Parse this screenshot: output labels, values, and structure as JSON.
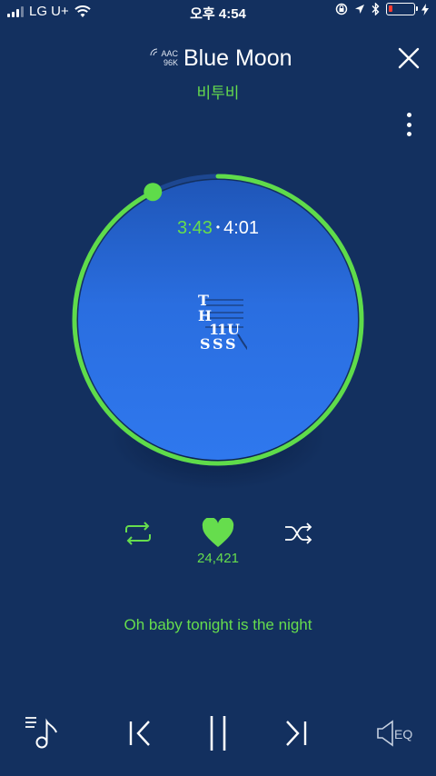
{
  "status_bar": {
    "carrier": "LG U+",
    "time": "오후 4:54",
    "battery_level": 0.1,
    "icons": [
      "signal-icon",
      "wifi-icon",
      "rotation-lock-icon",
      "location-icon",
      "bluetooth-icon",
      "battery-icon",
      "charging-icon"
    ]
  },
  "header": {
    "codec_line1": "AAC",
    "codec_line2": "96K",
    "title": "Blue Moon",
    "artist": "비투비",
    "close_icon": "close-icon",
    "more_icon": "more-vertical-icon"
  },
  "player": {
    "current_time": "3:43",
    "total_time": "4:01",
    "progress": 0.925,
    "album_art_letters": [
      "T",
      "H",
      "1",
      "1",
      "U",
      "S",
      "S",
      "S"
    ]
  },
  "actions": {
    "like_count": "24,421",
    "liked": true,
    "repeat_icon": "repeat-icon",
    "heart_icon": "heart-icon",
    "shuffle_icon": "shuffle-icon"
  },
  "lyrics": {
    "current_line": "Oh baby tonight is the night"
  },
  "controls": {
    "eq_label": "EQ",
    "icons": [
      "playlist-icon",
      "previous-icon",
      "pause-icon",
      "next-icon",
      "eq-icon"
    ]
  },
  "colors": {
    "background": "#13305f",
    "accent": "#66dd4d",
    "disc": "#2a6ee0"
  }
}
